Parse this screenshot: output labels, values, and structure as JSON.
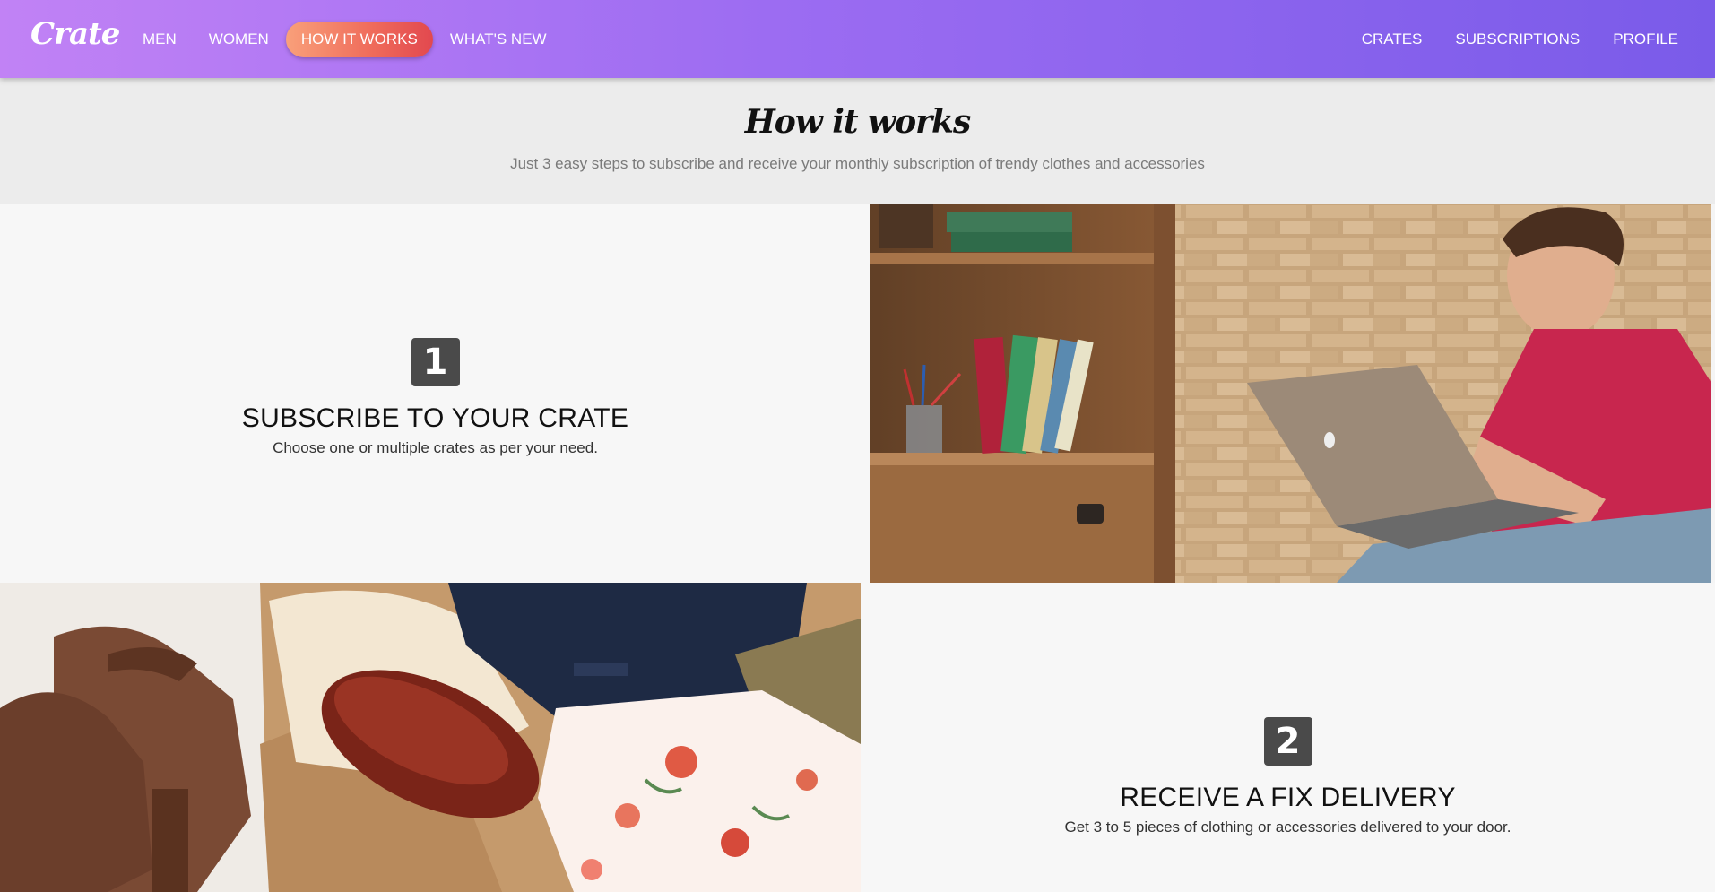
{
  "nav": {
    "logo": "Crate",
    "left_links": [
      "MEN",
      "WOMEN",
      "HOW IT WORKS",
      "WHAT'S NEW"
    ],
    "active_link": "HOW IT WORKS",
    "right_links": [
      "CRATES",
      "SUBSCRIPTIONS",
      "PROFILE"
    ]
  },
  "hero": {
    "title": "How it works",
    "subtitle": "Just 3 easy steps to subscribe and receive your monthly subscription of trendy clothes and accessories"
  },
  "steps": [
    {
      "number": "1",
      "title": "SUBSCRIBE TO YOUR CRATE",
      "description": "Choose one or multiple crates as per your need."
    },
    {
      "number": "2",
      "title": "RECEIVE A FIX DELIVERY",
      "description": "Get 3 to 5 pieces of clothing or accessories delivered to your door."
    }
  ],
  "colors": {
    "nav_gradient_start": "#c182f5",
    "nav_gradient_end": "#7a5be9",
    "active_pill_start": "#f9a07a",
    "active_pill_end": "#e2484f",
    "badge": "#4a4a4a"
  }
}
